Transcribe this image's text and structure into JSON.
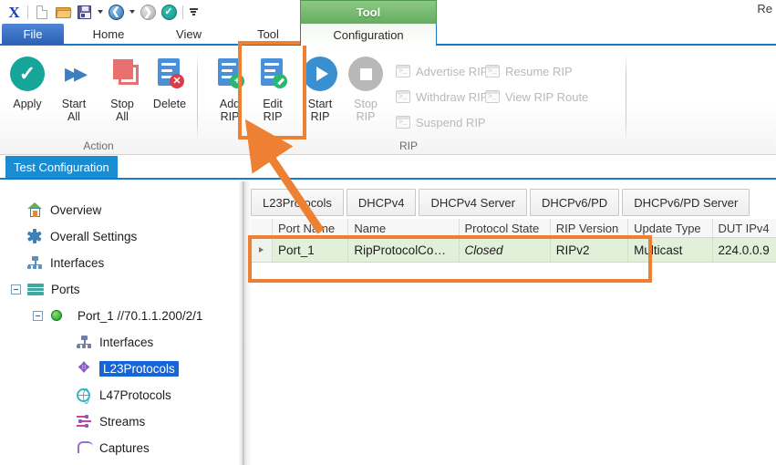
{
  "window": {
    "top_right_text": "Re"
  },
  "quick_access": {
    "items": [
      {
        "name": "app-logo-icon",
        "label": "X"
      },
      {
        "name": "new-icon",
        "label": "New"
      },
      {
        "name": "open-folder-icon",
        "label": "Open"
      },
      {
        "name": "save-icon",
        "label": "Save"
      },
      {
        "name": "back-icon",
        "label": "Back"
      },
      {
        "name": "forward-icon",
        "label": "Forward"
      },
      {
        "name": "apply-check-icon",
        "label": "Apply"
      },
      {
        "name": "customize-toolbar-icon",
        "label": "Customize Quick Access Toolbar"
      }
    ]
  },
  "ribbon": {
    "tabs": [
      {
        "label": "File",
        "active": false
      },
      {
        "label": "Home",
        "active": false
      },
      {
        "label": "View",
        "active": false
      },
      {
        "label": "Tool",
        "active": false
      }
    ],
    "contextual": {
      "group_title": "Tool",
      "tab_label": "Configuration"
    },
    "groups": [
      {
        "label": "Action",
        "buttons": [
          {
            "label_line1": "Apply",
            "label_line2": "",
            "icon": "check-circle-icon",
            "enabled": true
          },
          {
            "label_line1": "Start",
            "label_line2": "All",
            "icon": "double-chevron-right-icon",
            "enabled": true
          },
          {
            "label_line1": "Stop",
            "label_line2": "All",
            "icon": "stop-squares-icon",
            "enabled": true
          },
          {
            "label_line1": "Delete",
            "label_line2": "",
            "icon": "document-delete-icon",
            "enabled": true
          }
        ]
      },
      {
        "label": "RIP",
        "buttons": [
          {
            "label_line1": "Add",
            "label_line2": "RIP",
            "icon": "document-add-icon",
            "enabled": true
          },
          {
            "label_line1": "Edit",
            "label_line2": "RIP",
            "icon": "document-edit-icon",
            "enabled": true,
            "highlighted": true
          },
          {
            "label_line1": "Start",
            "label_line2": "RIP",
            "icon": "play-circle-icon",
            "enabled": true
          },
          {
            "label_line1": "Stop",
            "label_line2": "RIP",
            "icon": "stop-circle-icon",
            "enabled": false
          }
        ],
        "commands": [
          {
            "label": "Advertise RIP",
            "icon": "console-icon",
            "enabled": false
          },
          {
            "label": "Withdraw RIP",
            "icon": "console-icon",
            "enabled": false
          },
          {
            "label": "Suspend RIP",
            "icon": "console-icon",
            "enabled": false
          },
          {
            "label": "Resume RIP",
            "icon": "console-icon",
            "enabled": false
          },
          {
            "label": "View RIP Route",
            "icon": "console-icon",
            "enabled": false
          }
        ]
      }
    ]
  },
  "document_tabs": [
    {
      "label": "Test Configuration",
      "active": true
    }
  ],
  "tree": {
    "items": [
      {
        "label": "Overview",
        "icon": "home-icon",
        "indent": 0,
        "expander": "none",
        "selected": false
      },
      {
        "label": "Overall Settings",
        "icon": "gear-icon",
        "indent": 0,
        "expander": "none",
        "selected": false
      },
      {
        "label": "Interfaces",
        "icon": "network-icon",
        "indent": 0,
        "expander": "none",
        "selected": false
      },
      {
        "label": "Ports",
        "icon": "ports-icon",
        "indent": 0,
        "expander": "minus",
        "selected": false
      },
      {
        "label": "Port_1 //70.1.1.200/2/1",
        "icon": "green-status-dot-icon",
        "indent": 1,
        "expander": "minus",
        "selected": false
      },
      {
        "label": "Interfaces",
        "icon": "network-icon",
        "indent": 2,
        "expander": "none",
        "selected": false
      },
      {
        "label": "L23Protocols",
        "icon": "l23-protocols-icon",
        "indent": 2,
        "expander": "none",
        "selected": true
      },
      {
        "label": "L47Protocols",
        "icon": "globe-icon",
        "indent": 2,
        "expander": "none",
        "selected": false
      },
      {
        "label": "Streams",
        "icon": "streams-icon",
        "indent": 2,
        "expander": "none",
        "selected": false
      },
      {
        "label": "Captures",
        "icon": "captures-icon",
        "indent": 2,
        "expander": "none",
        "selected": false
      }
    ]
  },
  "content": {
    "tabs": [
      {
        "label": "L23Protocols",
        "active": true
      },
      {
        "label": "DHCPv4",
        "active": false
      },
      {
        "label": "DHCPv4 Server",
        "active": false
      },
      {
        "label": "DHCPv6/PD",
        "active": false
      },
      {
        "label": "DHCPv6/PD Server",
        "active": false
      }
    ],
    "grid": {
      "columns": [
        "Port Name",
        "Name",
        "Protocol State",
        "RIP Version",
        "Update Type",
        "DUT IPv4"
      ],
      "rows": [
        {
          "selected": true,
          "cells": [
            "Port_1",
            "RipProtocolCo…",
            "Closed",
            "RIPv2",
            "Multicast",
            "224.0.0.9"
          ]
        }
      ]
    }
  },
  "annotations": {
    "highlight_color": "#ee8033",
    "boxes": [
      {
        "name": "edit-rip-highlight",
        "target": "Edit RIP"
      },
      {
        "name": "grid-row-highlight",
        "target": "Port_1 row"
      }
    ],
    "arrow": {
      "from": "grid-row",
      "to": "Edit RIP button"
    }
  }
}
